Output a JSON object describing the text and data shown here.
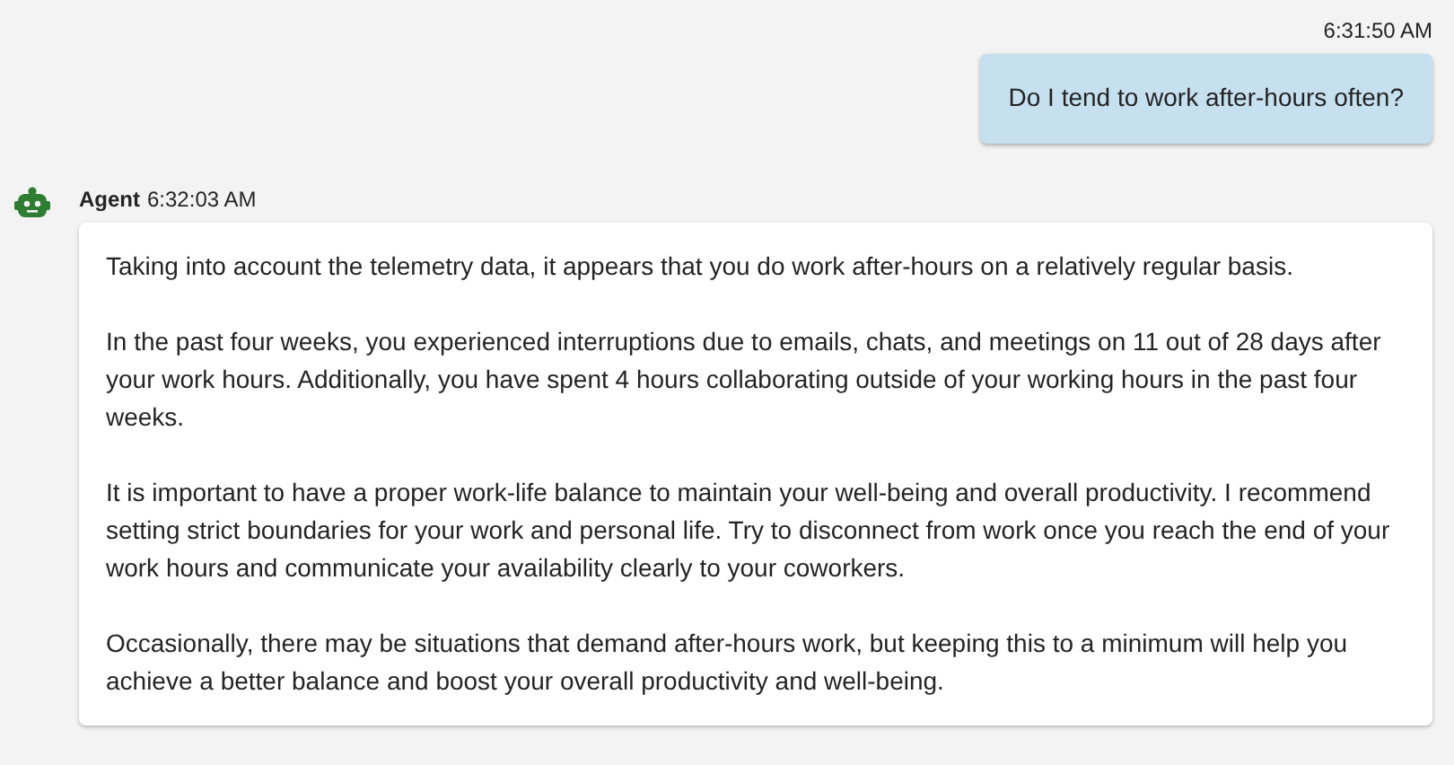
{
  "messages": [
    {
      "kind": "user",
      "time": "6:31:50 AM",
      "paragraphs": [
        "Do I tend to work after-hours often?"
      ]
    },
    {
      "kind": "agent",
      "sender": "Agent",
      "time": "6:32:03 AM",
      "paragraphs": [
        "Taking into account the telemetry data, it appears that you do work after-hours on a relatively regular basis.",
        "In the past four weeks, you experienced interruptions due to emails, chats, and meetings on 11 out of 28 days after your work hours. Additionally, you have spent 4 hours collaborating outside of your working hours in the past four weeks.",
        "It is important to have a proper work-life balance to maintain your well-being and overall productivity. I recommend setting strict boundaries for your work and personal life. Try to disconnect from work once you reach the end of your work hours and communicate your availability clearly to your coworkers.",
        "Occasionally, there may be situations that demand after-hours work, but keeping this to a minimum will help you achieve a better balance and boost your overall productivity and well-being."
      ]
    }
  ]
}
